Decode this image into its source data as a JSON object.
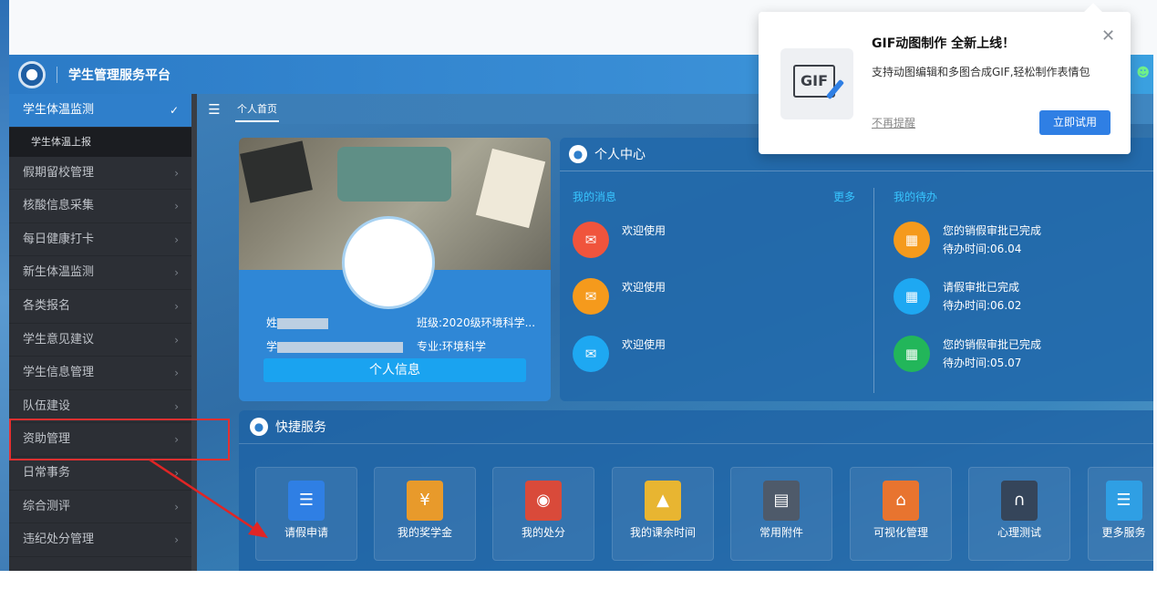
{
  "header": {
    "app_title": "学生管理服务平台",
    "user_icon": "user-icon"
  },
  "sidebar": {
    "items": [
      {
        "label": "学生体温监测",
        "active": true,
        "sub": [
          "学生体温上报"
        ]
      },
      {
        "label": "假期留校管理"
      },
      {
        "label": "核酸信息采集"
      },
      {
        "label": "每日健康打卡"
      },
      {
        "label": "新生体温监测"
      },
      {
        "label": "各类报名"
      },
      {
        "label": "学生意见建议"
      },
      {
        "label": "学生信息管理"
      },
      {
        "label": "队伍建设"
      },
      {
        "label": "资助管理"
      },
      {
        "label": "日常事务"
      },
      {
        "label": "综合测评"
      },
      {
        "label": "违纪处分管理"
      }
    ]
  },
  "tabs": {
    "home": "个人首页"
  },
  "profile": {
    "name_prefix": "姓",
    "id_prefix": "学",
    "class": "班级:2020级环境科学...",
    "major": "专业:环境科学",
    "button": "个人信息"
  },
  "center": {
    "title": "个人中心",
    "messages_title": "我的消息",
    "more": "更多",
    "todo_title": "我的待办",
    "messages": [
      {
        "text": "欢迎使用",
        "color": "#f0543c"
      },
      {
        "text": "欢迎使用",
        "color": "#f59a1c"
      },
      {
        "text": "欢迎使用",
        "color": "#1ea8f2"
      }
    ],
    "todos": [
      {
        "title": "您的销假审批已完成",
        "time": "待办时间:06.04",
        "color": "#f59a1c"
      },
      {
        "title": "请假审批已完成",
        "time": "待办时间:06.02",
        "color": "#1ea8f2"
      },
      {
        "title": "您的销假审批已完成",
        "time": "待办时间:05.07",
        "color": "#22b65a"
      }
    ]
  },
  "quick": {
    "title": "快捷服务",
    "items": [
      {
        "label": "请假申请",
        "color": "#2f7fe4"
      },
      {
        "label": "我的奖学金",
        "color": "#e89a2b"
      },
      {
        "label": "我的处分",
        "color": "#d94a3a"
      },
      {
        "label": "我的课余时间",
        "color": "#e8b531"
      },
      {
        "label": "常用附件",
        "color": "#4e5a6a"
      },
      {
        "label": "可视化管理",
        "color": "#e8742f"
      },
      {
        "label": "心理测试",
        "color": "#35455a"
      },
      {
        "label": "更多服务",
        "color": "#2f9fe4"
      }
    ]
  },
  "popup": {
    "title": "GIF动图制作 全新上线！",
    "desc": "支持动图编辑和多图合成GIF,轻松制作表情包",
    "dismiss": "不再提醒",
    "button": "立即试用",
    "icon_text": "GIF"
  }
}
